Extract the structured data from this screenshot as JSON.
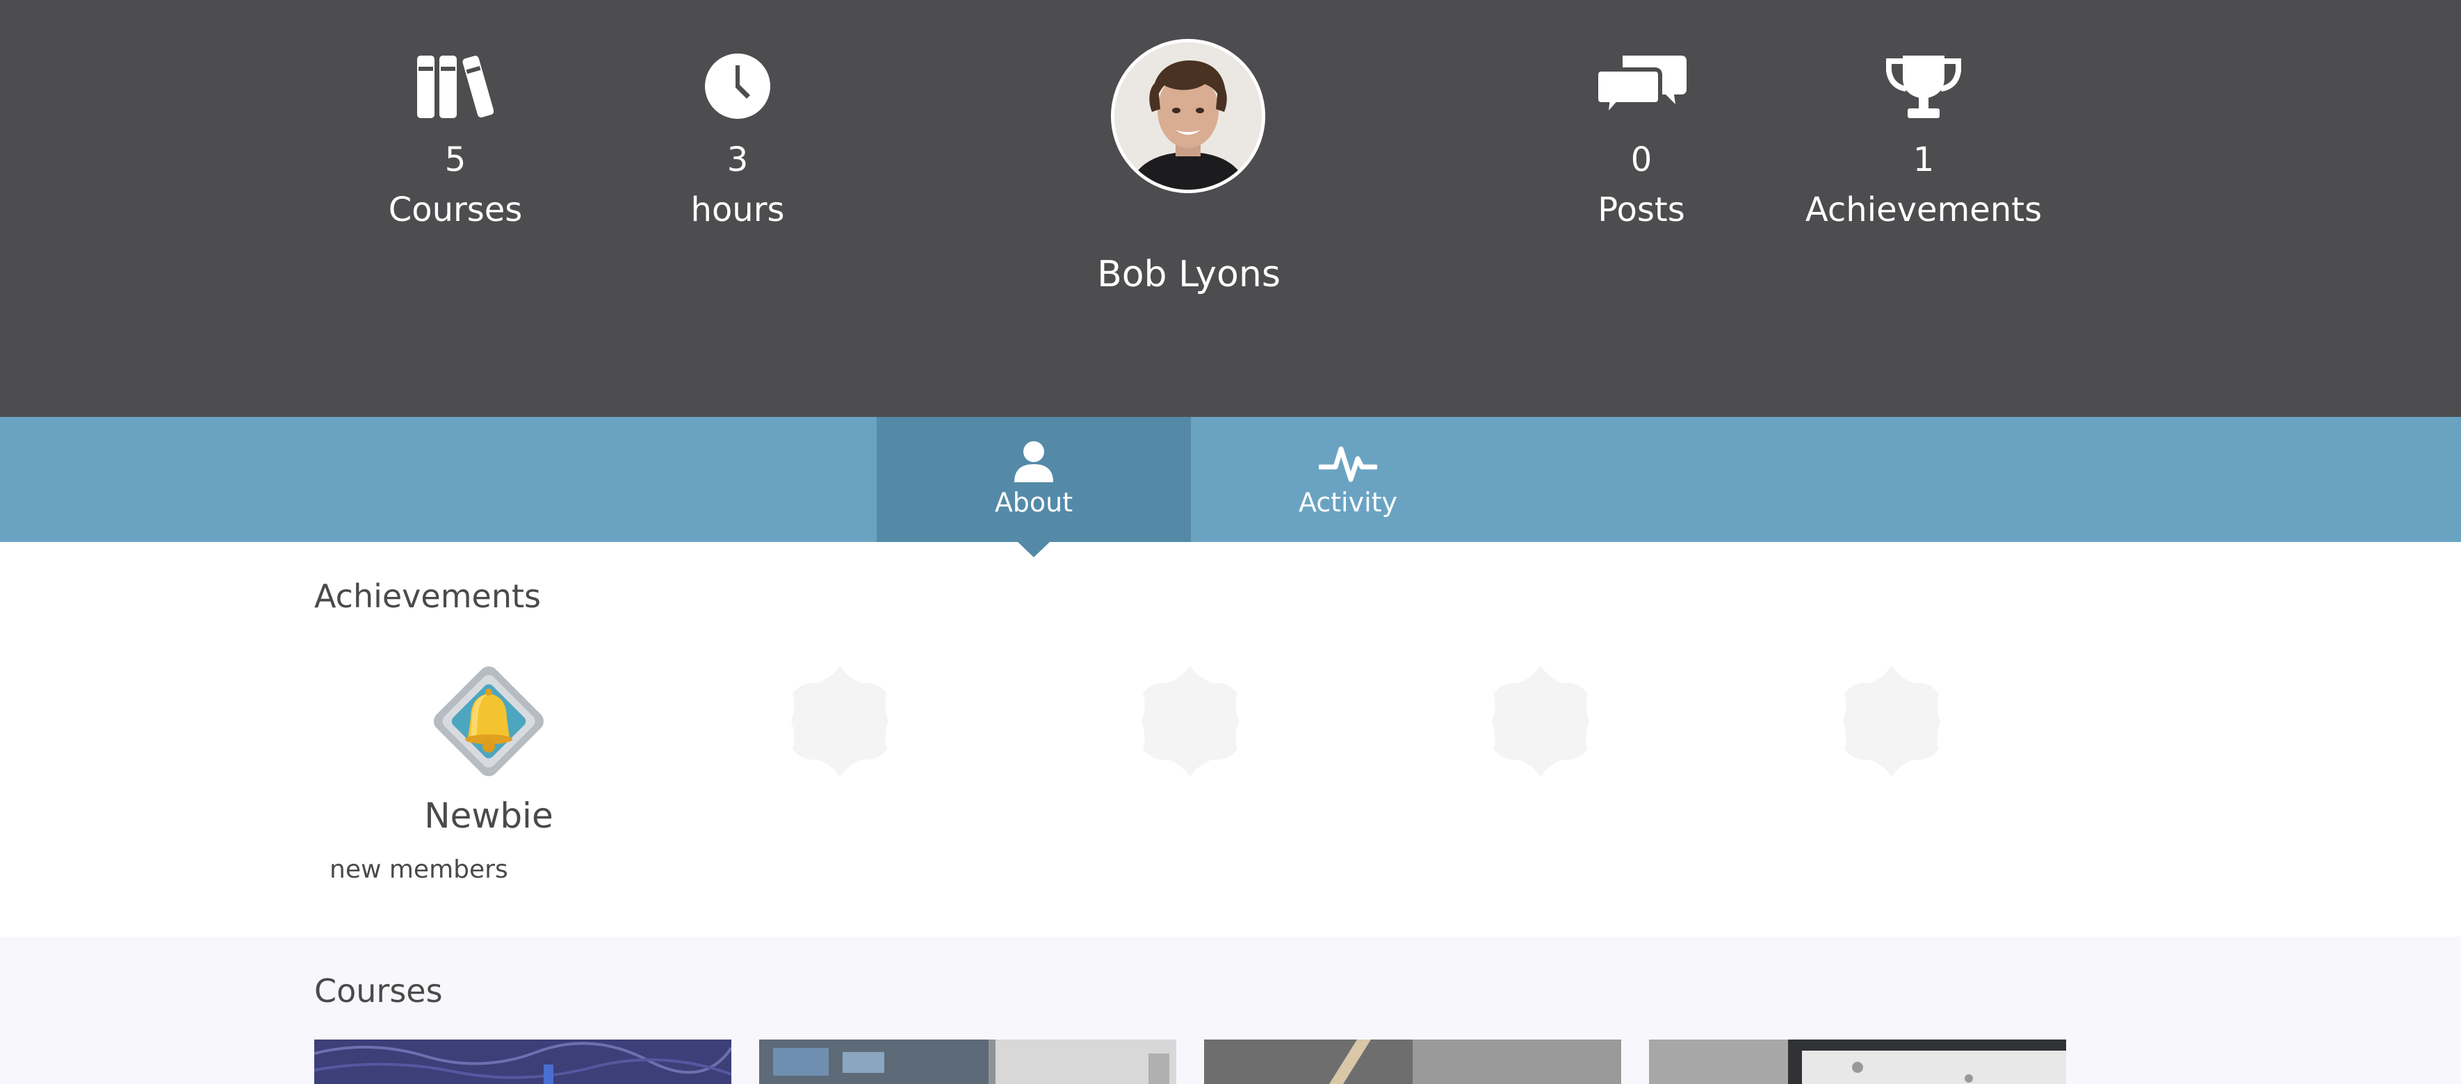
{
  "header": {
    "stats": {
      "courses": {
        "value": "5",
        "label": "Courses",
        "icon": "books-icon"
      },
      "hours": {
        "value": "3",
        "label": "hours",
        "icon": "clock-icon"
      },
      "posts": {
        "value": "0",
        "label": "Posts",
        "icon": "comments-icon"
      },
      "achievements": {
        "value": "1",
        "label": "Achievements",
        "icon": "trophy-icon"
      }
    },
    "profile_name": "Bob Lyons"
  },
  "tabs": [
    {
      "label": "About",
      "icon": "user-icon",
      "active": true
    },
    {
      "label": "Activity",
      "icon": "pulse-icon",
      "active": false
    }
  ],
  "achievements": {
    "title": "Achievements",
    "badges": [
      {
        "name": "Newbie",
        "description": "new members",
        "icon": "bell-badge-icon",
        "earned": true
      },
      {
        "icon": "locked-badge-icon",
        "earned": false
      },
      {
        "icon": "locked-badge-icon",
        "earned": false
      },
      {
        "icon": "locked-badge-icon",
        "earned": false
      },
      {
        "icon": "locked-badge-icon",
        "earned": false
      }
    ]
  },
  "courses": {
    "title": "Courses",
    "card_count": 4
  },
  "colors": {
    "header_bg": "#4d4d4f",
    "tabbar_bg": "#6aa3c2",
    "active_tab_bg": "#548aa8",
    "courses_bg": "#f8f8fc",
    "text_dark": "#4a4a4a",
    "placeholder_badge": "#f4f4f4"
  }
}
